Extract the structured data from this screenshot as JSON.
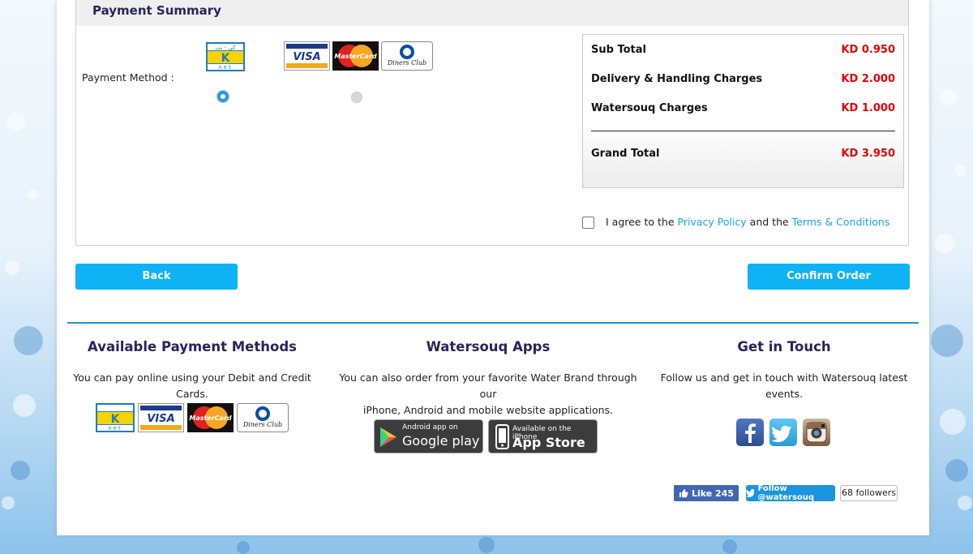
{
  "summary": {
    "header": "Payment Summary",
    "payment_method_label": "Payment Method :",
    "methods": [
      {
        "name": "knet-logo",
        "selected": true
      },
      {
        "name": "card-logos",
        "selected": false
      }
    ],
    "knet": {
      "top": "كي - نت",
      "k": "K",
      "bottom": "net"
    },
    "cards": {
      "visa": "VISA",
      "mastercard": "MasterCard",
      "diners": "Diners Club"
    }
  },
  "totals": {
    "rows": [
      {
        "label": "Sub Total",
        "amount": "KD 0.950"
      },
      {
        "label": "Delivery & Handling Charges",
        "amount": "KD 2.000"
      },
      {
        "label": "Watersouq Charges",
        "amount": "KD 1.000"
      }
    ],
    "grand": {
      "label": "Grand Total",
      "amount": "KD 3.950"
    }
  },
  "agree": {
    "prefix": "I agree to the",
    "privacy": "Privacy Policy",
    "middle": "and the",
    "terms": "Terms & Conditions",
    "checked": false
  },
  "buttons": {
    "back": "Back",
    "confirm": "Confirm Order"
  },
  "footer": {
    "payment": {
      "title": "Available Payment Methods",
      "text": "You can pay online using your Debit and Credit Cards."
    },
    "apps": {
      "title": "Watersouq Apps",
      "text1": "You can also order from your favorite Water Brand through our",
      "text2": "iPhone, Android and mobile website applications.",
      "google_small": "Android app on",
      "google_big": "Google play",
      "apple_small": "Available on the iPhone",
      "apple_big": "App Store"
    },
    "touch": {
      "title": "Get in Touch",
      "text1": "Follow us and get in touch with Watersouq latest",
      "text2": "events.",
      "icons": [
        "facebook-icon",
        "twitter-icon",
        "instagram-icon"
      ]
    },
    "social": {
      "like": "Like 245",
      "follow": "Follow @watersouq",
      "followers": "68 followers"
    }
  },
  "colors": {
    "accent": "#0fb2f5",
    "heading": "#26265c",
    "amount": "#e30000",
    "link": "#1aa3e6",
    "divider": "#1a96d9"
  }
}
